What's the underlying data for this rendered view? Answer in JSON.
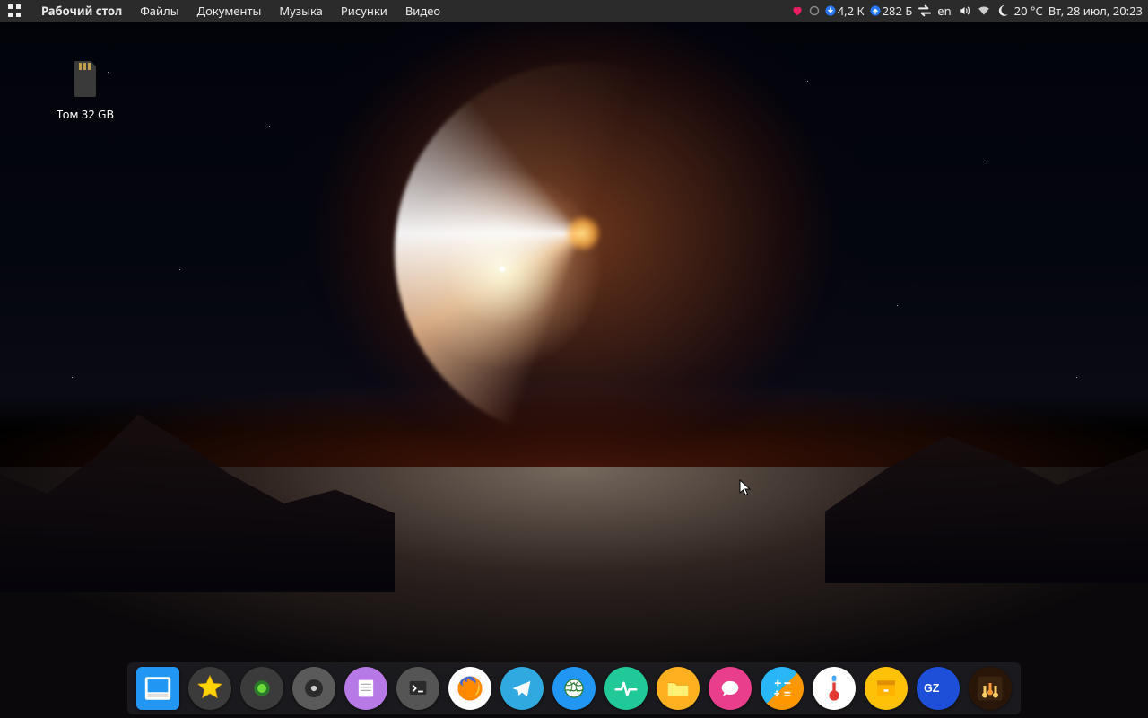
{
  "panel": {
    "app_name": "Рабочий стол",
    "menu": [
      "Файлы",
      "Документы",
      "Музыка",
      "Рисунки",
      "Видео"
    ],
    "net_down": "4,2 К",
    "net_up": "282 Б",
    "lang": "en",
    "temp": "20 °C",
    "datetime": "Вт, 28 июл, 20:23"
  },
  "desktop": {
    "volume_label": "Том 32 GB"
  },
  "dock": {
    "items": [
      {
        "name": "files",
        "color": "#2196f3"
      },
      {
        "name": "favorites",
        "color": "#3b3b3b"
      },
      {
        "name": "record",
        "color": "#3b3b3b"
      },
      {
        "name": "disc",
        "color": "#5a5a5a"
      },
      {
        "name": "notes",
        "color": "#b779e6"
      },
      {
        "name": "terminal",
        "color": "#555"
      },
      {
        "name": "firefox",
        "color": "#fff"
      },
      {
        "name": "telegram",
        "color": "#2fa9e0"
      },
      {
        "name": "browser",
        "color": "#2196f3"
      },
      {
        "name": "monitor",
        "color": "#20c997"
      },
      {
        "name": "folder",
        "color": "#ffb020"
      },
      {
        "name": "chat",
        "color": "#e83e8c"
      },
      {
        "name": "calculator",
        "color": "#888"
      },
      {
        "name": "thermometer",
        "color": "#fff"
      },
      {
        "name": "archive",
        "color": "#ffc107"
      },
      {
        "name": "gz",
        "color": "#1e4fd8"
      },
      {
        "name": "media",
        "color": "#2a1608"
      }
    ]
  }
}
